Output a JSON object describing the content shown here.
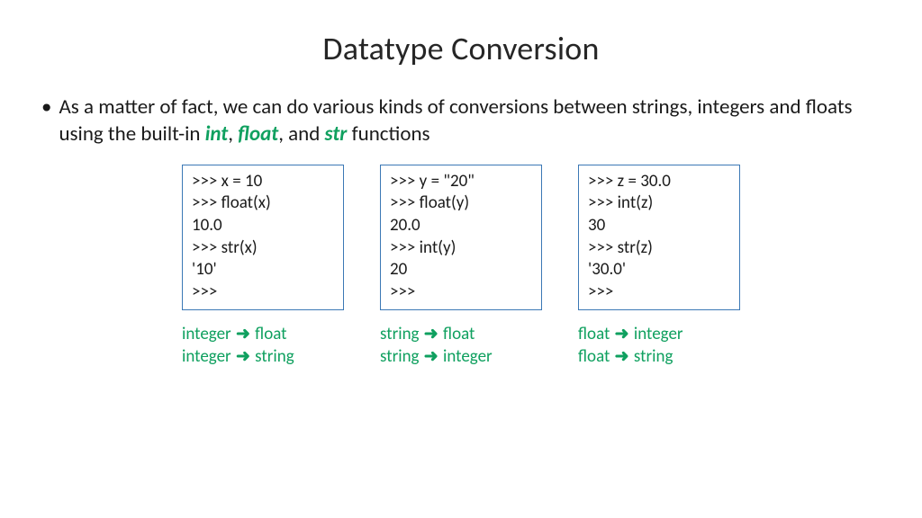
{
  "title": "Datatype Conversion",
  "bullet": {
    "pre": "As a matter of fact, we can do various kinds of conversions between strings, integers and floats using the built-in ",
    "kw1": "int",
    "sep1": ", ",
    "kw2": "float",
    "sep2": ", and ",
    "kw3": "str",
    "post": " functions"
  },
  "codeboxes": [
    ">>> x = 10\n>>> float(x)\n10.0\n>>> str(x)\n'10'\n>>>",
    ">>> y = \"20\"\n>>> float(y)\n20.0\n>>> int(y)\n20\n>>>",
    ">>> z = 30.0\n>>> int(z)\n30\n>>> str(z)\n'30.0'\n>>>"
  ],
  "arrow": "➜",
  "labels": [
    [
      {
        "from": "integer",
        "to": "float"
      },
      {
        "from": "integer",
        "to": "string"
      }
    ],
    [
      {
        "from": "string",
        "to": "float"
      },
      {
        "from": "string",
        "to": "integer"
      }
    ],
    [
      {
        "from": "float",
        "to": "integer"
      },
      {
        "from": "float",
        "to": "string"
      }
    ]
  ]
}
